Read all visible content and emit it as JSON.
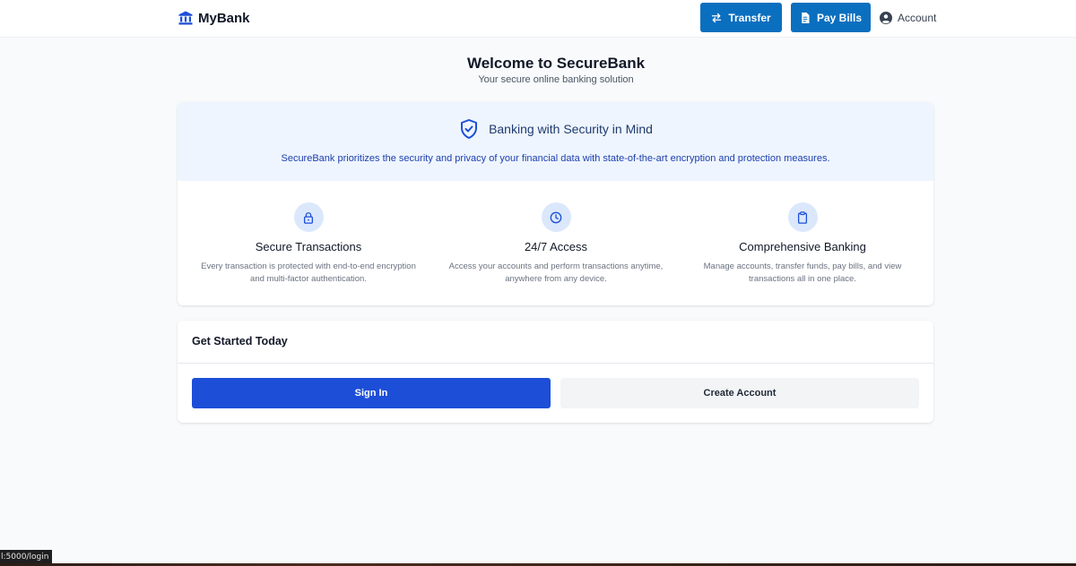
{
  "navbar": {
    "brand": "MyBank",
    "transfer_label": "Transfer",
    "paybills_label": "Pay Bills",
    "account_label": "Account"
  },
  "hero": {
    "title": "Welcome to SecureBank",
    "subtitle": "Your secure online banking solution"
  },
  "security": {
    "title": "Banking with Security in Mind",
    "description": "SecureBank prioritizes the security and privacy of your financial data with state-of-the-art encryption and protection measures.",
    "features": [
      {
        "icon": "lock-icon",
        "title": "Secure Transactions",
        "description": "Every transaction is protected with end-to-end encryption and multi-factor authentication."
      },
      {
        "icon": "clock-icon",
        "title": "24/7 Access",
        "description": "Access your accounts and perform transactions anytime, anywhere from any device."
      },
      {
        "icon": "clipboard-icon",
        "title": "Comprehensive Banking",
        "description": "Manage accounts, transfer funds, pay bills, and view transactions all in one place."
      }
    ]
  },
  "get_started": {
    "title": "Get Started Today",
    "signin_label": "Sign In",
    "create_label": "Create Account"
  },
  "status_bar": {
    "url": "l:5000/login"
  },
  "colors": {
    "nav_button": "#0b6fbf",
    "primary": "#1d4ed8",
    "icon_blue": "#1d4ed8",
    "banner_bg": "#eef5fe"
  }
}
